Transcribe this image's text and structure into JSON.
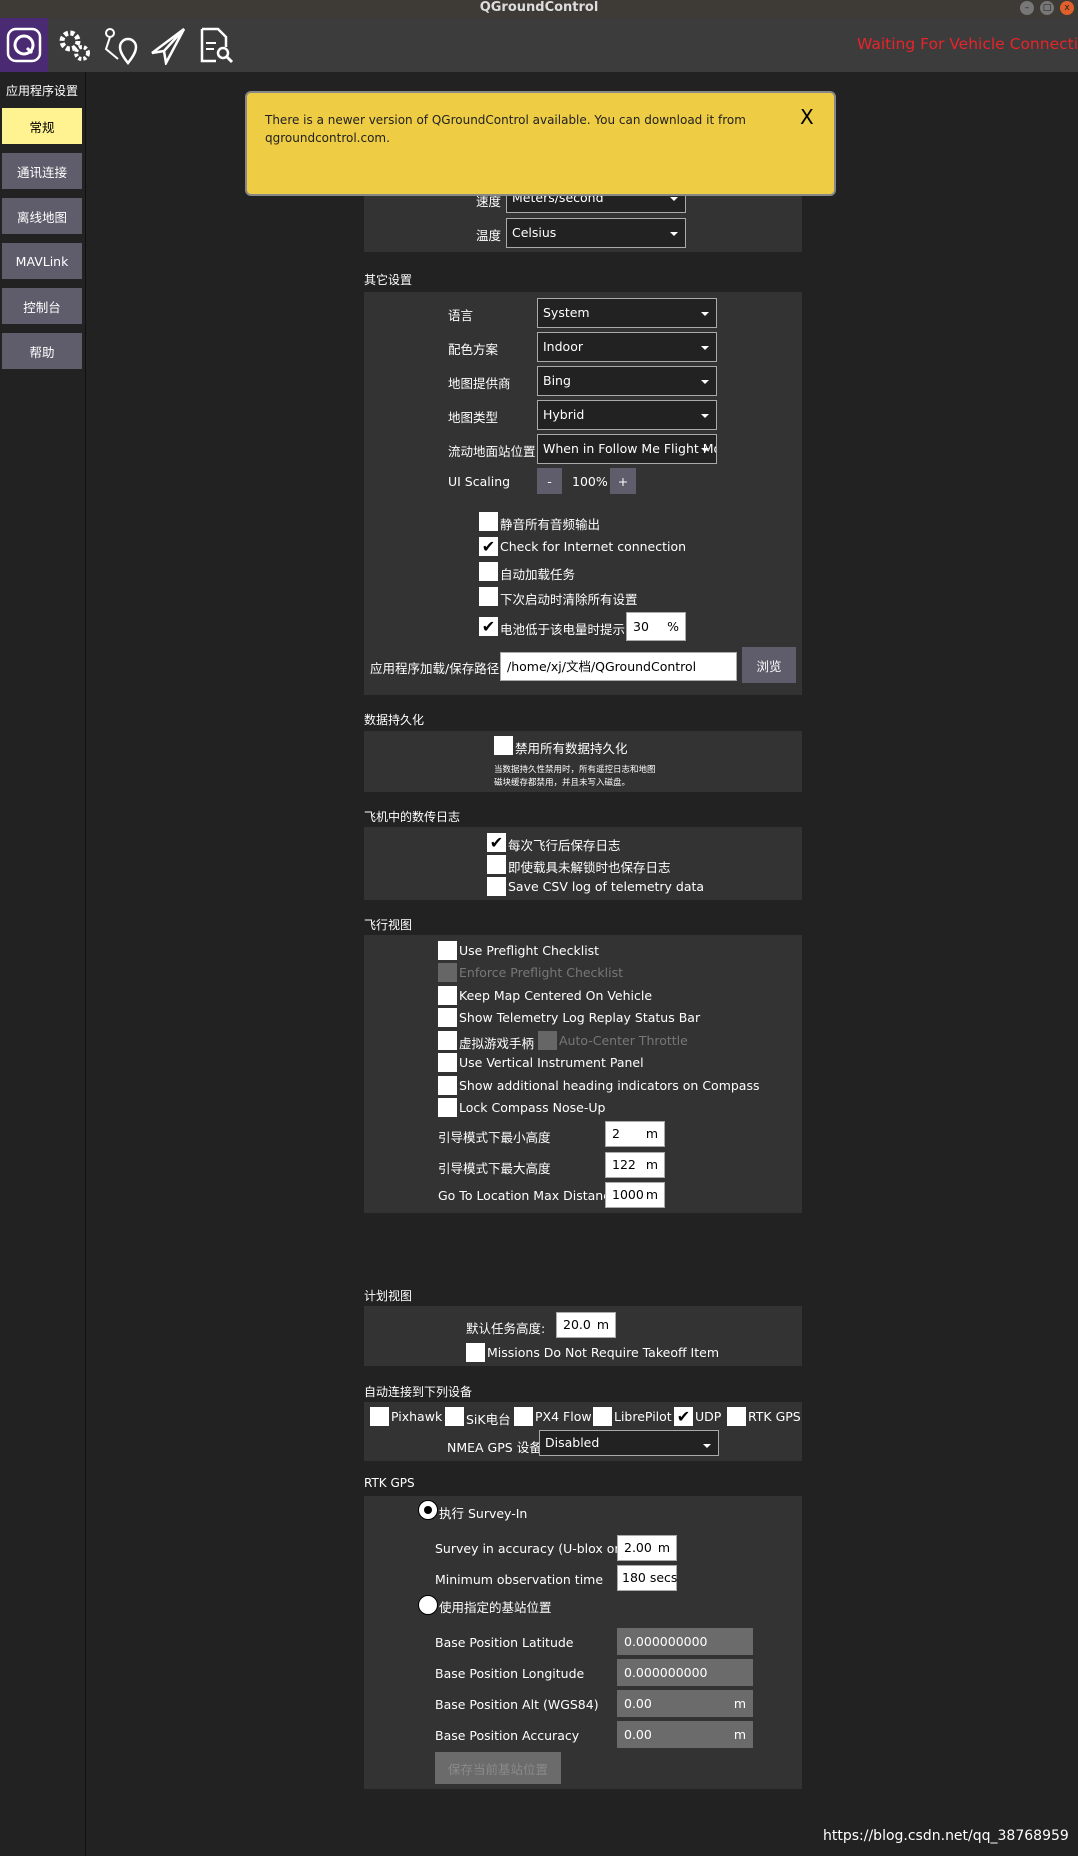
{
  "window": {
    "title": "QGroundControl"
  },
  "toolbar": {
    "icons": [
      "qgc-logo-icon",
      "gear-icon",
      "plan-icon",
      "paper-plane-icon",
      "analyze-icon"
    ],
    "status": "Waiting For Vehicle Connection",
    "status_color": "#e8232a"
  },
  "sidebar": {
    "heading": "应用程序设置",
    "items": [
      {
        "label": "常规",
        "selected": true
      },
      {
        "label": "通讯连接"
      },
      {
        "label": "离线地图"
      },
      {
        "label": "MAVLink"
      },
      {
        "label": "控制台"
      },
      {
        "label": "帮助"
      }
    ]
  },
  "banner": {
    "text1": "There is a newer version of QGroundControl available. You can download it from",
    "text2": "qgroundcontrol.com.",
    "close": "X",
    "color": "#eecc44"
  },
  "units": {
    "speed_label": "速度",
    "speed_value": "Meters/second",
    "temp_label": "温度",
    "temp_value": "Celsius"
  },
  "misc": {
    "heading": "其它设置",
    "language_label": "语言",
    "language": "System",
    "color_label": "配色方案",
    "color": "Indoor",
    "map_provider_label": "地图提供商",
    "map_provider": "Bing",
    "map_type_label": "地图类型",
    "map_type": "Hybrid",
    "stream_gcs_label": "流动地面站位置",
    "stream_gcs": "When in Follow Me Flight Mode",
    "ui_scaling_label": "UI Scaling",
    "ui_scaling_minus": "-",
    "ui_scaling": "100%",
    "ui_scaling_plus": "+",
    "checks": [
      {
        "label": "静音所有音频输出",
        "checked": false
      },
      {
        "label": "Check for Internet connection",
        "checked": true
      },
      {
        "label": "自动加载任务",
        "checked": false
      },
      {
        "label": "下次启动时清除所有设置",
        "checked": false
      }
    ],
    "battery_label": "电池低于该电量时提示",
    "battery_checked": true,
    "battery_value": "30",
    "battery_unit": "%",
    "path_label": "应用程序加载/保存路径",
    "path": "/home/xj/文档/QGroundControl",
    "browse": "浏览"
  },
  "persistence": {
    "heading": "数据持久化",
    "disable_label": "禁用所有数据持久化",
    "note1": "当数据持久性禁用时，所有遥控日志和地图",
    "note2": "磁块缓存都禁用，并且未写入磁盘。"
  },
  "telemetry": {
    "heading": "飞机中的数传日志",
    "checks": [
      {
        "label": "每次飞行后保存日志",
        "checked": true
      },
      {
        "label": "即使载具未解锁时也保存日志",
        "checked": false
      },
      {
        "label": "Save CSV log of telemetry data",
        "checked": false
      }
    ]
  },
  "fly_view": {
    "heading": "飞行视图",
    "checks": [
      {
        "label": "Use Preflight Checklist"
      },
      {
        "label": "Enforce Preflight Checklist",
        "disabled": true
      },
      {
        "label": "Keep Map Centered On Vehicle"
      },
      {
        "label": "Show Telemetry Log Replay Status Bar"
      },
      {
        "label": "虚拟游戏手柄"
      },
      {
        "label": "Use Vertical Instrument Panel"
      },
      {
        "label": "Show additional heading indicators on Compass"
      },
      {
        "label": "Lock Compass Nose-Up"
      }
    ],
    "auto_center": "Auto-Center Throttle",
    "min_alt_label": "引导模式下最小高度",
    "min_alt": "2",
    "max_alt_label": "引导模式下最大高度",
    "max_alt": "122",
    "goto_label": "Go To Location Max Distance",
    "goto": "1000",
    "unit": "m"
  },
  "plan_view": {
    "heading": "计划视图",
    "alt_label": "默认任务高度:",
    "alt": "20.0",
    "unit": "m",
    "takeoff_label": "Missions Do Not Require Takeoff Item"
  },
  "autoconnect": {
    "heading": "自动连接到下列设备",
    "devices": [
      {
        "label": "Pixhawk",
        "checked": false
      },
      {
        "label": "SiK电台",
        "checked": false
      },
      {
        "label": "PX4 Flow",
        "checked": false
      },
      {
        "label": "LibrePilot",
        "checked": false
      },
      {
        "label": "UDP",
        "checked": true
      },
      {
        "label": "RTK GPS",
        "checked": false
      }
    ],
    "nmea_label": "NMEA GPS 设备",
    "nmea": "Disabled"
  },
  "rtk": {
    "heading": "RTK GPS",
    "survey_label": "执行 Survey-In",
    "accuracy_label": "Survey in accuracy (U-blox only)",
    "accuracy": "2.00",
    "accuracy_unit": "m",
    "min_time_label": "Minimum observation time",
    "min_time": "180 secs",
    "fixed_label": "使用指定的基站位置",
    "lat_label": "Base Position Latitude",
    "lat": "0.000000000",
    "lon_label": "Base Position Longitude",
    "lon": "0.000000000",
    "alt_label": "Base Position Alt (WGS84)",
    "alt": "0.00",
    "acc_label": "Base Position Accuracy",
    "acc": "0.00",
    "unit": "m",
    "save": "保存当前基站位置"
  },
  "watermark": "https://blog.csdn.net/qq_38768959"
}
